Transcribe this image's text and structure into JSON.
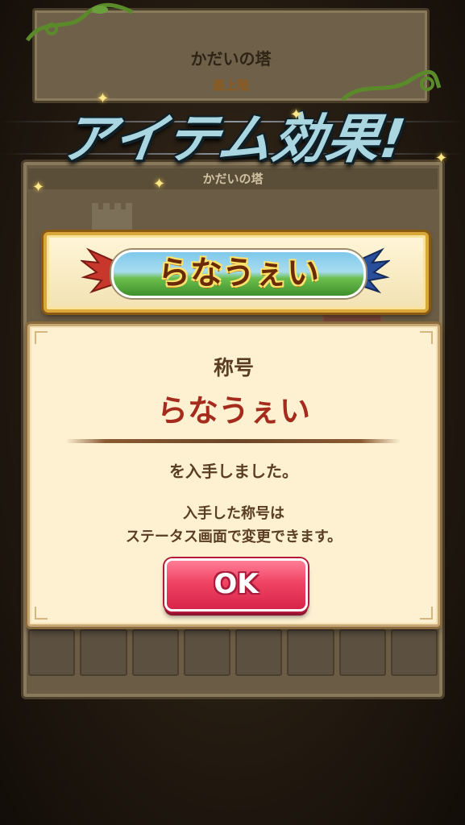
{
  "tower_card": {
    "title": "かだいの塔",
    "floor": "最上階"
  },
  "banner": {
    "text": "アイテム効果!"
  },
  "panel": {
    "header": "かだいの塔"
  },
  "title_plate": {
    "text": "らなうぇい"
  },
  "dialog": {
    "label": "称号",
    "title_name": "らなうぇい",
    "obtained": "を入手しました。",
    "note_line1": "入手した称号は",
    "note_line2": "ステータス画面で変更できます。",
    "ok_label": "OK"
  },
  "colors": {
    "accent_red": "#a52c1c",
    "ok_button": "#f04464",
    "dialog_bg": "#fdf1d2",
    "banner_text": "#a9d6e0"
  }
}
